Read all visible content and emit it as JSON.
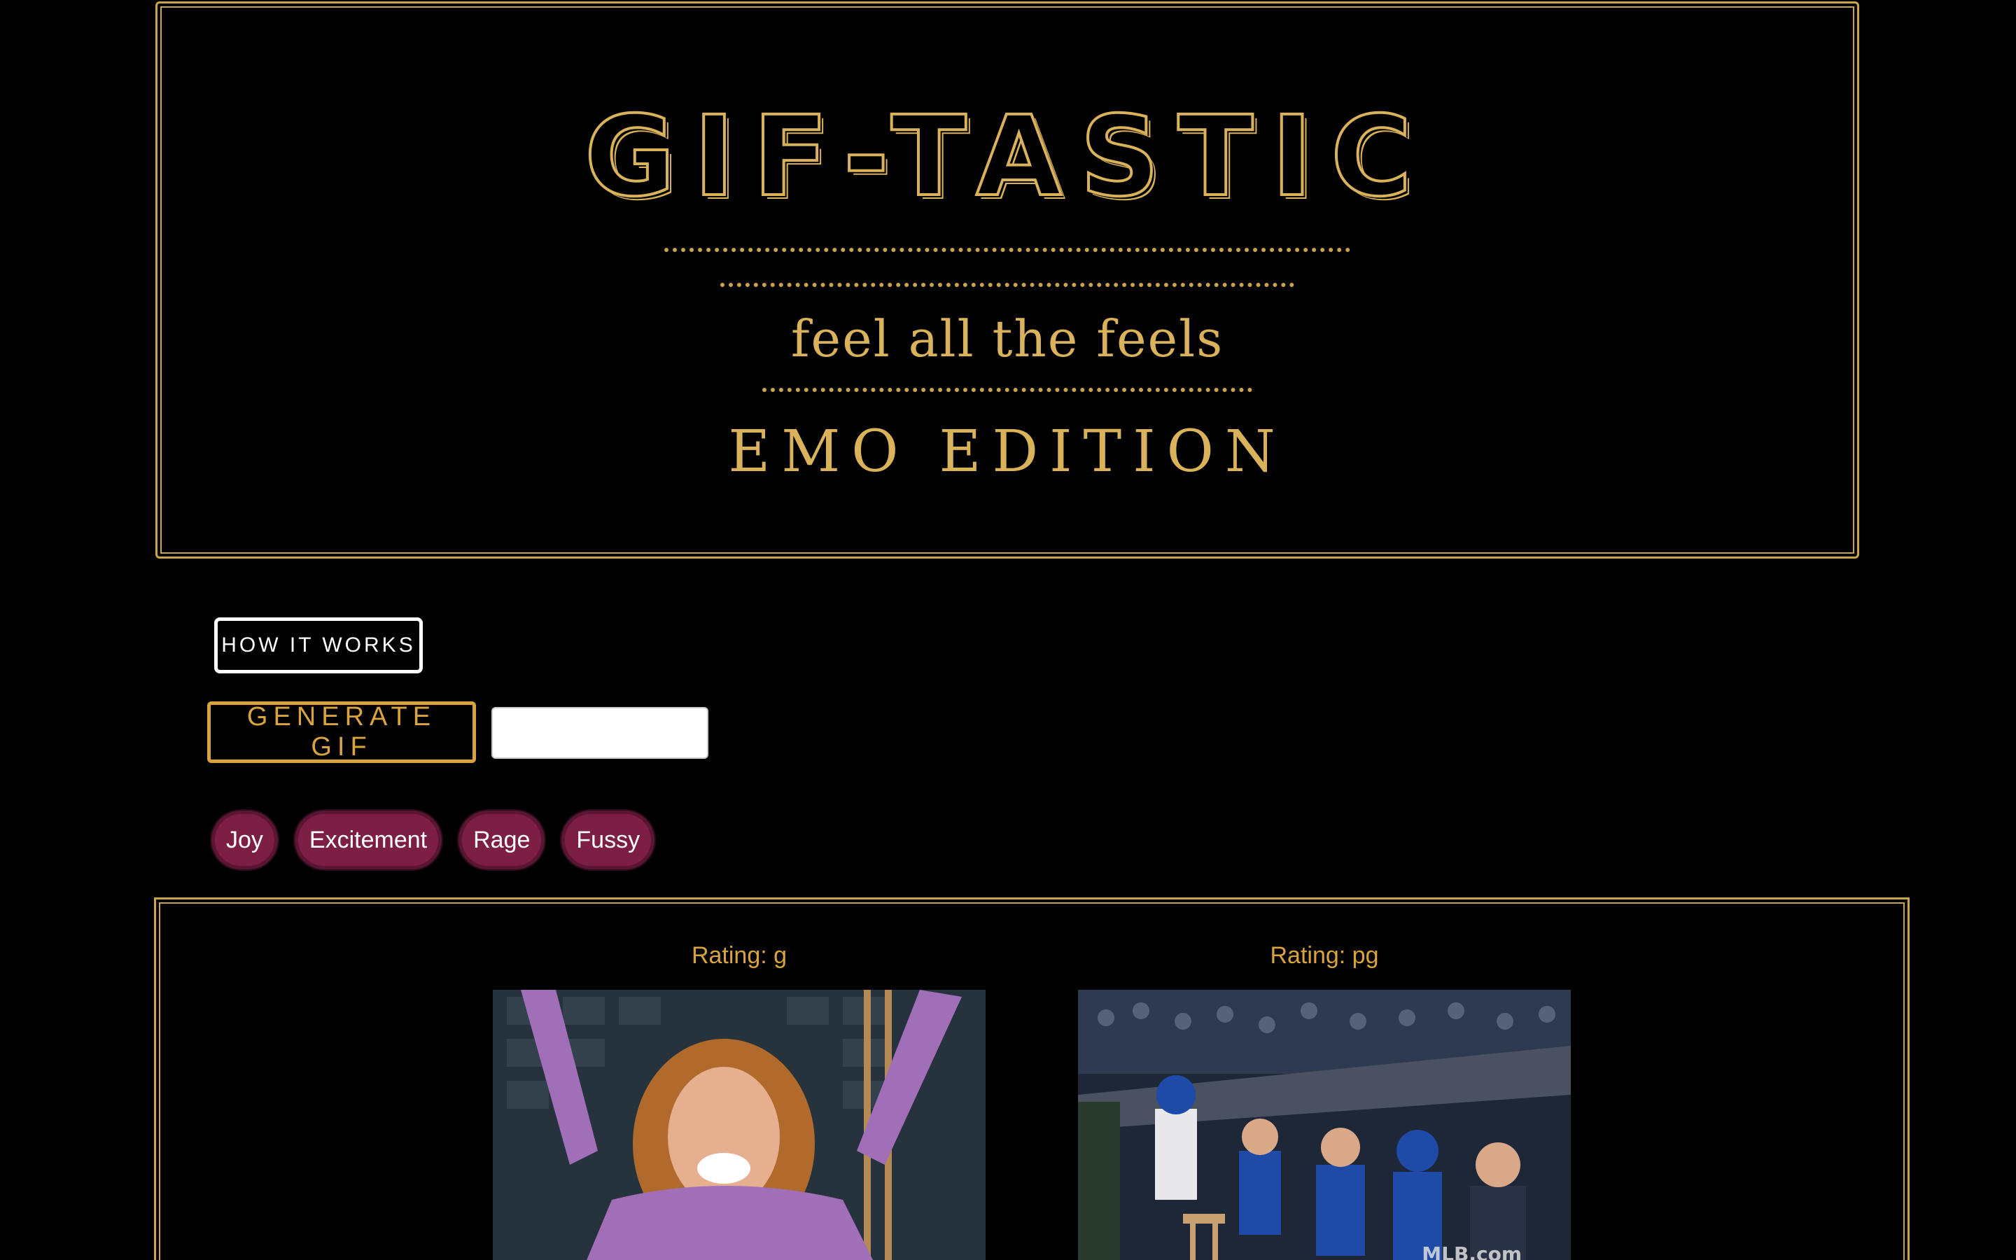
{
  "header": {
    "title": "GIF-TASTIC",
    "subtitle": "feel all the feels",
    "edition": "EMO EDITION"
  },
  "controls": {
    "how_it_works_label": "HOW IT WORKS",
    "generate_label": "GENERATE GIF",
    "input_value": "",
    "input_placeholder": ""
  },
  "chips": [
    {
      "label": "Joy"
    },
    {
      "label": "Excitement"
    },
    {
      "label": "Rage"
    },
    {
      "label": "Fussy"
    }
  ],
  "results": [
    {
      "rating": "Rating: g",
      "image": "woman-cheering-gif"
    },
    {
      "rating": "Rating: pg",
      "image": "baseball-dugout-cheering-gif",
      "watermark": "MLB.com"
    }
  ],
  "colors": {
    "background": "#000000",
    "gold": "#d9b25a",
    "button_gold": "#d9a440",
    "chip": "#7d1e45",
    "white": "#ffffff"
  }
}
